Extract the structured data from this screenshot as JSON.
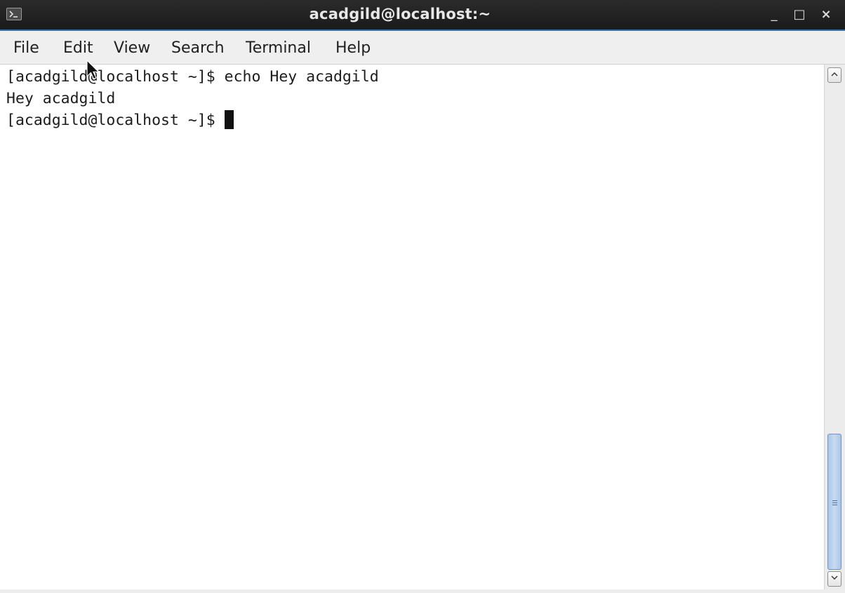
{
  "window": {
    "title": "acadgild@localhost:~",
    "controls": {
      "minimize": "_",
      "maximize": "□",
      "close": "×"
    },
    "icon": "terminal-icon"
  },
  "menu": {
    "items": [
      "File",
      "Edit",
      "View",
      "Search",
      "Terminal",
      "Help"
    ]
  },
  "terminal": {
    "lines": [
      "[acadgild@localhost ~]$ echo Hey acadgild",
      "Hey acadgild",
      "[acadgild@localhost ~]$ "
    ]
  },
  "scrollbar": {
    "position_fraction": 1.0,
    "visible_fraction": 0.28
  },
  "colors": {
    "titlebar": "#1e1e1e",
    "titlebar_accent": "#3a6ea5",
    "menubar": "#efefef",
    "terminal_bg": "#ffffff",
    "terminal_fg": "#1c1c1c",
    "scroll_thumb": "#b6d0ee"
  }
}
